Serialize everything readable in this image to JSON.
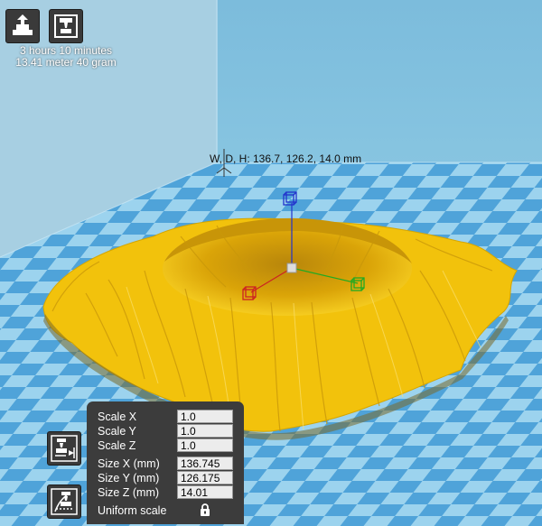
{
  "toolbar": {
    "load_icon": "load-model-icon",
    "print_icon": "print-icon"
  },
  "print_info": {
    "time": "3 hours 10 minutes",
    "material": "13.41 meter 40 gram"
  },
  "dimensions_label": "W, D, H: 136.7, 126.2, 14.0 mm",
  "side_tools": {
    "scale_icon": "scale-icon",
    "mirror_icon": "mirror-icon"
  },
  "scale_panel": {
    "scale_x_label": "Scale X",
    "scale_x_value": "1.0",
    "scale_y_label": "Scale Y",
    "scale_y_value": "1.0",
    "scale_z_label": "Scale Z",
    "scale_z_value": "1.0",
    "size_x_label": "Size X (mm)",
    "size_x_value": "136.745",
    "size_y_label": "Size Y (mm)",
    "size_y_value": "126.175",
    "size_z_label": "Size Z (mm)",
    "size_z_value": "14.01",
    "uniform_label": "Uniform scale",
    "uniform_icon": "lock-icon"
  },
  "colors": {
    "model": "#f2c20c",
    "sky": "#7fbedc",
    "floor_light": "#9cd3ee",
    "floor_dark": "#4a9fd8",
    "panel": "#3c3c3c"
  }
}
